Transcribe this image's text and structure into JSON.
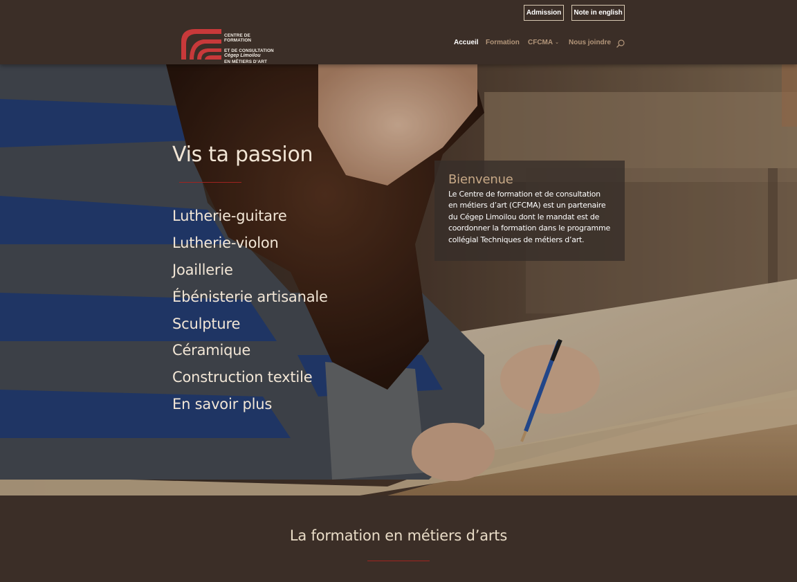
{
  "header": {
    "admission_label": "Admission",
    "english_label": "Note in english",
    "logo": {
      "line1": "CENTRE DE FORMATION",
      "line2": "ET DE CONSULTATION",
      "line3": "EN MÉTIERS D’ART",
      "subtitle": "Cégep Limoilou",
      "mark_color": "#c8393a"
    },
    "nav": {
      "items": [
        {
          "label": "Accueil",
          "active": true
        },
        {
          "label": "Formation",
          "active": false
        },
        {
          "label": "CFCMA",
          "active": false,
          "has_dropdown": true
        },
        {
          "label": "Nous joindre",
          "active": false
        }
      ],
      "search_icon": "search-icon"
    }
  },
  "hero": {
    "title": "Vis ta passion",
    "programs": [
      "Lutherie-guitare",
      "Lutherie-violon",
      "Joaillerie",
      "Ébénisterie artisanale",
      "Sculpture",
      "Céramique",
      "Construction textile",
      "En savoir plus"
    ],
    "welcome": {
      "title": "Bienvenue",
      "body": "Le Centre de formation et de consultation en métiers d’art (CFCMA) est un partenaire du Cégep Limoilou dont le mandat est de coordonner la formation dans le programme collégial Techniques de métiers d’art."
    }
  },
  "section": {
    "title": "La formation en métiers d’arts"
  },
  "colors": {
    "background": "#3b2e27",
    "accent_red": "#a0231f",
    "nav_link": "#b3967a",
    "welcome_title": "#c7a886",
    "hero_text": "#f2e6d6"
  }
}
